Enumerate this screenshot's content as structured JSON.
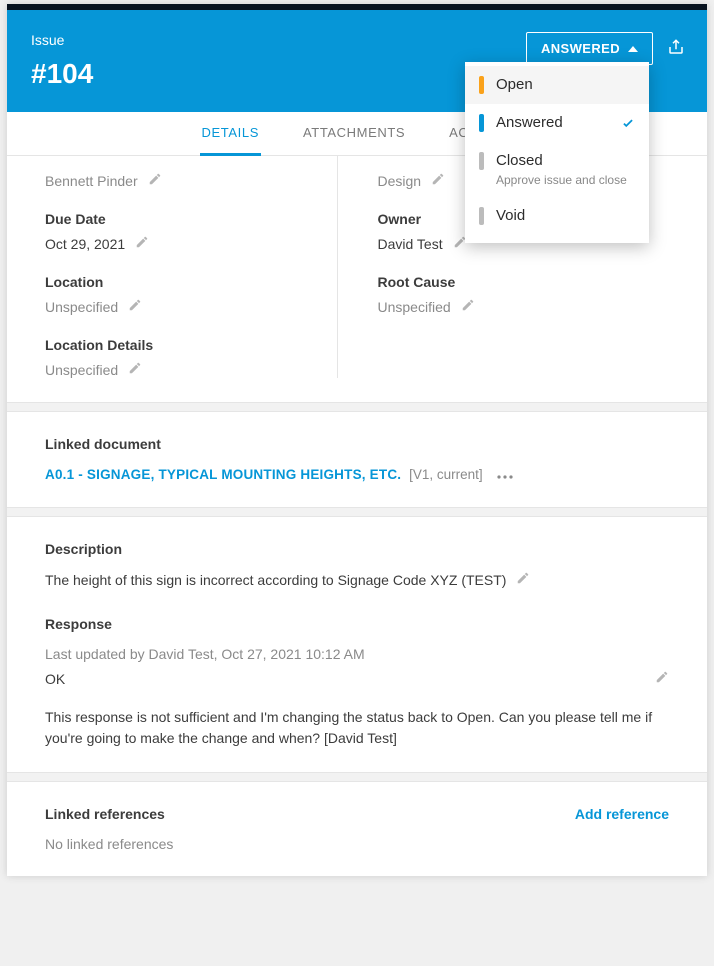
{
  "header": {
    "issue_label": "Issue",
    "issue_id": "#104",
    "status_button": "ANSWERED"
  },
  "status_menu": {
    "items": [
      {
        "label": "Open",
        "color": "#FAA21B",
        "sub": "",
        "selected": false,
        "highlighted": true
      },
      {
        "label": "Answered",
        "color": "#0696D7",
        "sub": "",
        "selected": true,
        "highlighted": false
      },
      {
        "label": "Closed",
        "color": "#BCBCBC",
        "sub": "Approve issue and close",
        "selected": false,
        "highlighted": false
      },
      {
        "label": "Void",
        "color": "#BCBCBC",
        "sub": "",
        "selected": false,
        "highlighted": false
      }
    ]
  },
  "tabs": [
    {
      "label": "DETAILS",
      "active": true
    },
    {
      "label": "ATTACHMENTS",
      "active": false
    },
    {
      "label": "ACTIVITY",
      "active": false
    }
  ],
  "fields": {
    "left": {
      "stale_author": "Bennett Pinder",
      "due_date": {
        "label": "Due Date",
        "value": "Oct 29, 2021"
      },
      "location": {
        "label": "Location",
        "value": "Unspecified"
      },
      "location_details": {
        "label": "Location Details",
        "value": "Unspecified"
      }
    },
    "right": {
      "stale_category": "Design",
      "owner": {
        "label": "Owner",
        "value": "David Test"
      },
      "root_cause": {
        "label": "Root Cause",
        "value": "Unspecified"
      }
    }
  },
  "linked_doc": {
    "section_label": "Linked document",
    "name": "A0.1 - SIGNAGE, TYPICAL MOUNTING HEIGHTS, ETC.",
    "meta": "[V1, current]"
  },
  "description": {
    "section_label": "Description",
    "text": "The height of this sign is incorrect according to Signage Code XYZ (TEST)"
  },
  "response": {
    "section_label": "Response",
    "meta": "Last updated by David Test, Oct 27, 2021 10:12 AM",
    "text": "OK",
    "note": "This response is not sufficient and I'm changing the status back to Open. Can you please tell me if you're going to make the change and when? [David Test]"
  },
  "linked_refs": {
    "section_label": "Linked references",
    "add_label": "Add reference",
    "empty_text": "No linked references"
  }
}
